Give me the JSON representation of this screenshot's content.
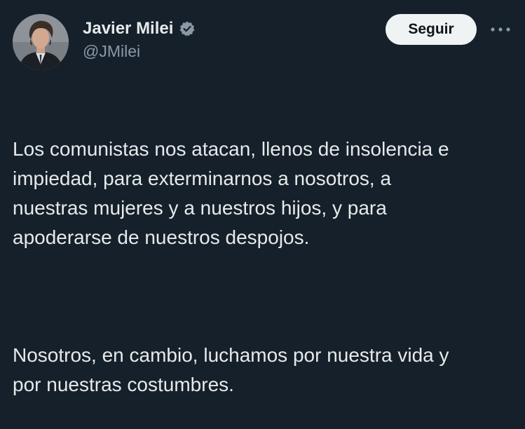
{
  "author": {
    "display_name": "Javier Milei",
    "handle": "@JMilei",
    "verified": true,
    "avatar_icon": "profile-photo-icon"
  },
  "actions": {
    "follow_label": "Seguir",
    "more_icon": "more-options-icon"
  },
  "tweet": {
    "paragraph_1": "Los comunistas nos atacan, llenos de insolencia e\nimpiedad, para exterminarnos a nosotros, a\nnuestras mujeres y a nuestros hijos, y para\napoderarse de nuestros despojos.",
    "paragraph_2": "Nosotros, en cambio, luchamos por nuestra vida y\npor nuestras costumbres."
  },
  "colors": {
    "background": "#15202b",
    "text": "#e7e9ea",
    "secondary_text": "#8b98a5",
    "verified_badge": "#8b98a5",
    "follow_button_bg": "#eff3f4",
    "follow_button_text": "#0f1419"
  }
}
